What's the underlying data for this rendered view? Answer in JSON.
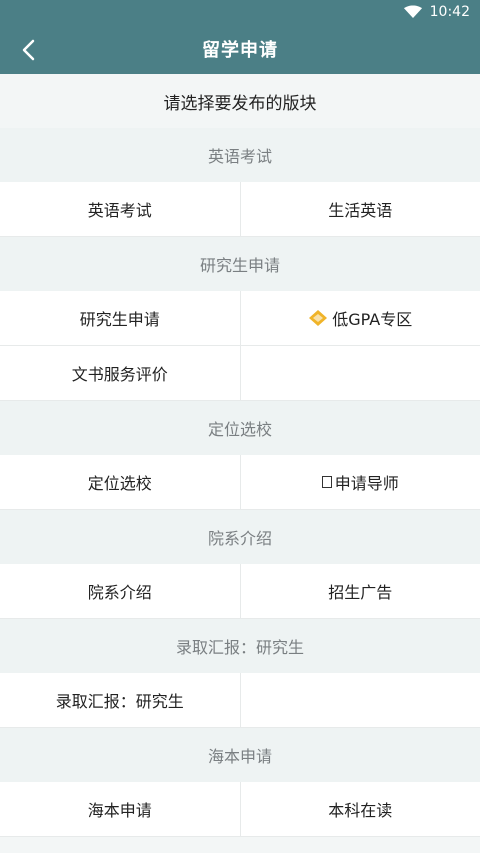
{
  "status": {
    "time": "10:42"
  },
  "header": {
    "title": "留学申请"
  },
  "subtitle": "请选择要发布的版块",
  "sections": [
    {
      "title": "英语考试",
      "items": [
        "英语考试",
        "生活英语"
      ]
    },
    {
      "title": "研究生申请",
      "items": [
        "研究生申请",
        "低GPA专区",
        "文书服务评价"
      ]
    },
    {
      "title": "定位选校",
      "items": [
        "定位选校",
        "申请导师"
      ]
    },
    {
      "title": "院系介绍",
      "items": [
        "院系介绍",
        "招生广告"
      ]
    },
    {
      "title": "录取汇报：研究生",
      "items": [
        "录取汇报：研究生"
      ]
    },
    {
      "title": "海本申请",
      "items": [
        "海本申请",
        "本科在读"
      ]
    }
  ],
  "icons": {
    "diamond_color": "#f0b429"
  }
}
